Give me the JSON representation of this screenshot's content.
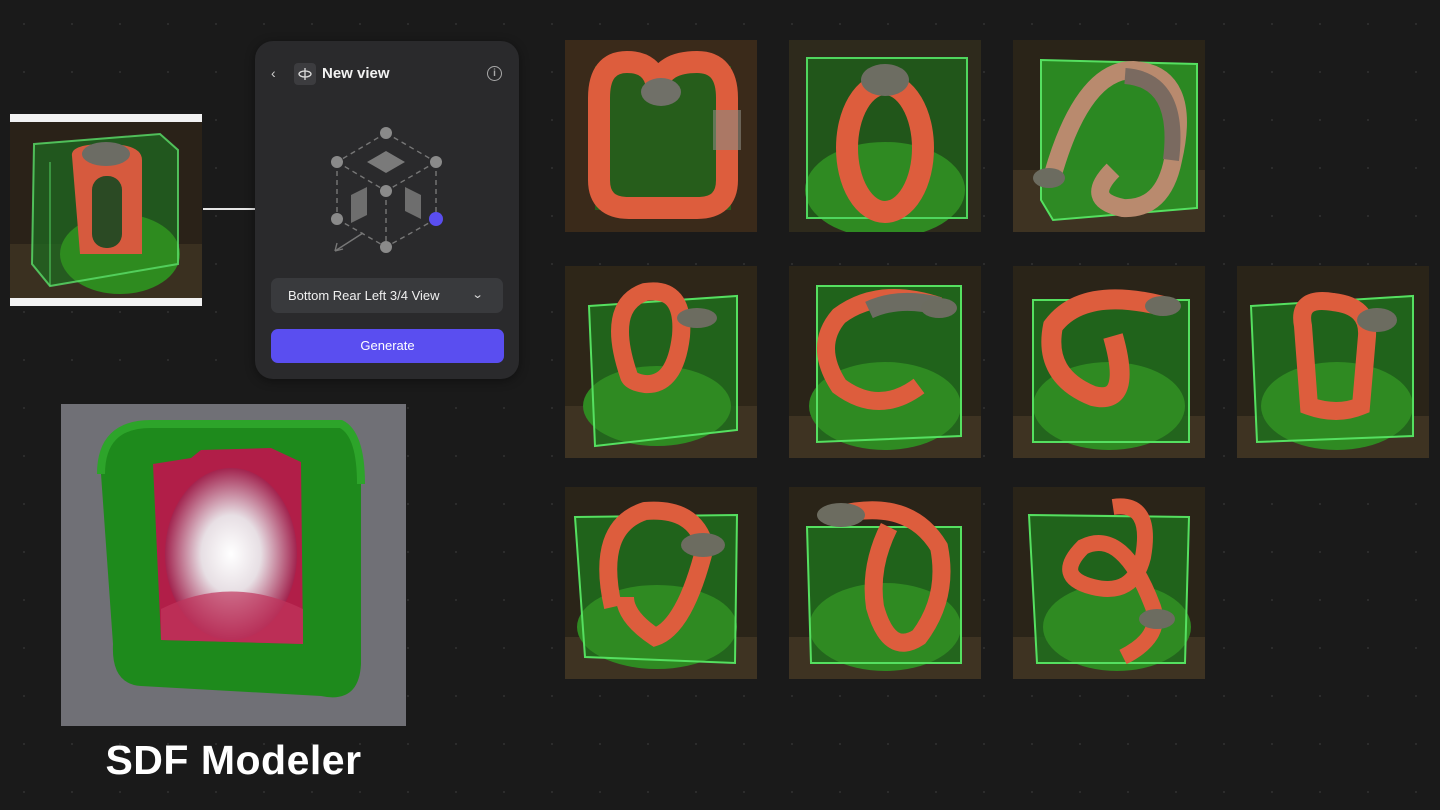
{
  "panel": {
    "title": "New view",
    "back_icon": "chevron-left-icon",
    "view_icon": "orbit-view-icon",
    "info_icon": "info-icon",
    "selected_view": "Bottom Rear Left 3/4 View",
    "generate_label": "Generate",
    "accent_color": "#5a4ef0"
  },
  "sdf": {
    "caption": "SDF Modeler"
  },
  "thumbnails": [
    {
      "id": "view-1"
    },
    {
      "id": "view-2"
    },
    {
      "id": "view-3"
    },
    {
      "id": "view-4"
    },
    {
      "id": "view-5"
    },
    {
      "id": "view-6"
    },
    {
      "id": "view-7"
    },
    {
      "id": "view-8"
    },
    {
      "id": "view-9"
    },
    {
      "id": "view-10"
    }
  ],
  "colors": {
    "background": "#1a1a1a",
    "panel": "#2a2a2c",
    "snake_body": "#d8583c",
    "moss": "#2f8a22",
    "glass": "#37c24a"
  }
}
